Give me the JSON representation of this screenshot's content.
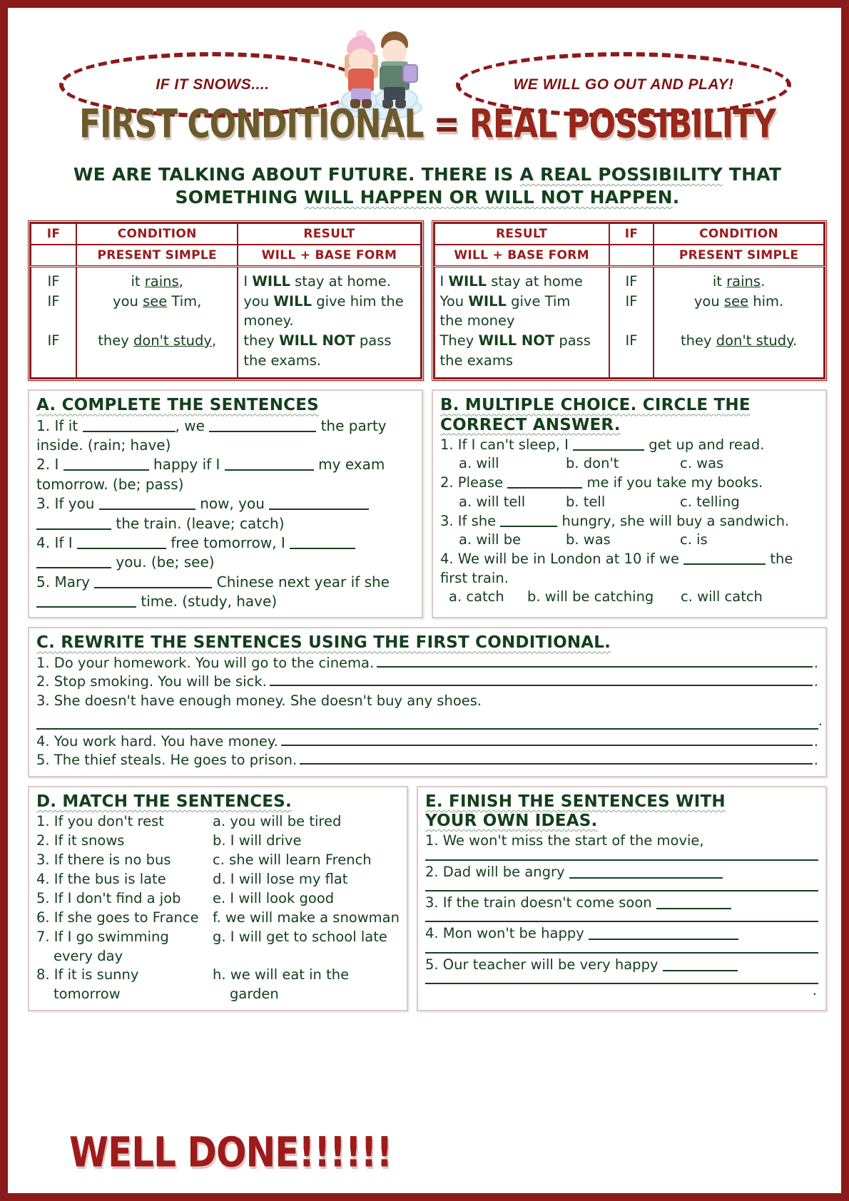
{
  "header": {
    "bubble_left": "IF IT SNOWS....",
    "bubble_right": "WE WILL GO OUT AND PLAY!",
    "title_part1": "FIRST CONDITIONAL",
    "title_eq": " = ",
    "title_part2": "REAL POSSIBILITY",
    "clipart": "two-kids-in-snow"
  },
  "intro": {
    "line1_a": "WE ARE TALKING ABOUT FUTURE. THERE IS ",
    "line1_b": "A REAL POSSIBILITY",
    "line1_c": " THAT",
    "line2_a": "SOMETHING ",
    "line2_b": "WILL HAPPEN OR WILL NOT HAPPEN",
    "line2_c": "."
  },
  "table_left": {
    "head": [
      "IF",
      "CONDITION",
      "RESULT"
    ],
    "subhead": [
      "",
      "PRESENT SIMPLE",
      "WILL + BASE FORM"
    ],
    "if_col": [
      "IF",
      "IF",
      "",
      "IF"
    ],
    "condition_col": [
      "it rains,",
      "you see Tim,",
      "",
      "they don't study,"
    ],
    "condition_underlines": [
      "rains",
      "see",
      "",
      "don't study"
    ],
    "result_col": [
      "I WILL stay at home.",
      "you WILL give him the",
      "money.",
      "they WILL NOT pass",
      "the exams."
    ]
  },
  "table_right": {
    "head": [
      "RESULT",
      "IF",
      "CONDITION"
    ],
    "subhead": [
      "WILL + BASE FORM",
      "",
      "PRESENT SIMPLE"
    ],
    "result_col": [
      "I WILL stay at home",
      "You WILL give Tim",
      "the money",
      "They WILL NOT pass",
      "the exams"
    ],
    "if_col": [
      "IF",
      "IF",
      "",
      "IF"
    ],
    "condition_col": [
      "it rains.",
      "you see him.",
      "",
      "they don't study."
    ]
  },
  "exercise_a": {
    "title": "A. COMPLETE THE SENTENCES",
    "items": [
      "1. If it ______________, we _______________ the party inside. (rain; have)",
      "2. I ____________ happy if I ____________ my exam tomorrow. (be; pass)",
      "3. If you _____________ now, you _____________ __________ the train. (leave; catch)",
      "4. If I ____________ free tomorrow, I _________ __________ you. (be; see)",
      "5. Mary _________________ Chinese next year if she ______________ time. (study, have)"
    ]
  },
  "exercise_b": {
    "title_line1": "B. MULTIPLE CHOICE. CIRCLE THE",
    "title_line2": "CORRECT ANSWER.",
    "questions": [
      {
        "stem": "1. If I can't sleep, I _________ get up and read.",
        "options": [
          "a. will",
          "b. don't",
          "c. was"
        ]
      },
      {
        "stem": "2. Please _________ me if you take my books.",
        "options": [
          "a. will tell",
          "b. tell",
          "c. telling"
        ]
      },
      {
        "stem": "3. If she _______ hungry, she will buy a sandwich.",
        "options": [
          "a. will be",
          "b. was",
          "c. is"
        ]
      },
      {
        "stem": "4. We will be in London at 10 if we __________ the first train.",
        "options": [
          "a. catch",
          "b. will be catching",
          "c. will catch"
        ]
      }
    ]
  },
  "exercise_c": {
    "title": "C. REWRITE THE SENTENCES USING THE FIRST CONDITIONAL.",
    "items": [
      "1. Do your homework. You will go to the cinema.",
      "2. Stop smoking. You will be sick.",
      "3. She doesn't have enough money. She doesn't buy any shoes.",
      "4. You work hard. You have money.",
      "5. The thief steals. He goes to prison."
    ],
    "end_mark": "."
  },
  "exercise_d": {
    "title": "D. MATCH THE SENTENCES.",
    "left": [
      "1. If you don't rest",
      "2. If it snows",
      "3. If there is no bus",
      "4. If the bus is late",
      "5. If I don't find a job",
      "6. If she goes to France",
      "7. If I go swimming",
      "every day",
      "8. If it is sunny",
      "tomorrow"
    ],
    "right": [
      "a. you will be tired",
      "b. I will drive",
      "c. she will learn French",
      "d. I will lose my flat",
      "e. I will look good",
      "f. we will make a snowman",
      "g. I will get to school late",
      "",
      "h. we will eat in the",
      "garden"
    ]
  },
  "exercise_e": {
    "title_line1": "E. FINISH THE SENTENCES WITH",
    "title_line2": "YOUR OWN IDEAS.",
    "items": [
      "1. We won't miss the start of the movie,",
      "2. Dad will be angry",
      "3. If the train doesn't come soon",
      "4. Mon won't be happy",
      "5. Our teacher will be very happy"
    ],
    "end_mark": "."
  },
  "footer": {
    "well_done": "WELL DONE!!!!!!"
  },
  "colors": {
    "frame_red": "#8c1a1a",
    "title_red": "#8a2116",
    "text_green": "#14401c",
    "table_header_red": "#9c1b1b"
  }
}
